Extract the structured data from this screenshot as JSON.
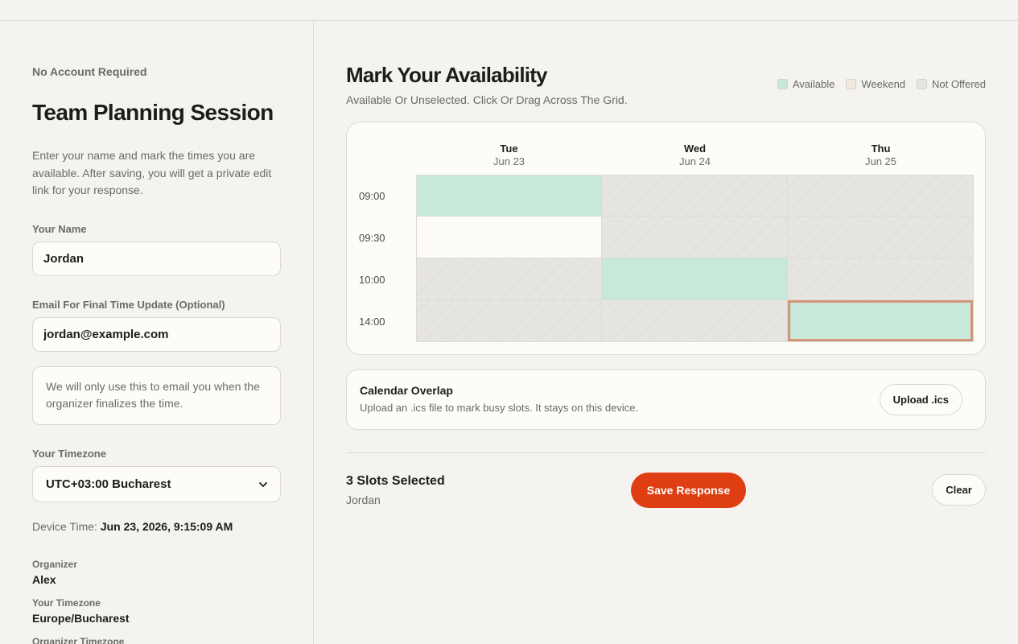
{
  "sidebar": {
    "eyebrow": "No Account Required",
    "title": "Team Planning Session",
    "intro": "Enter your name and mark the times you are available. After saving, you will get a private edit link for your response.",
    "name_label": "Your Name",
    "name_value": "Jordan",
    "email_label": "Email For Final Time Update (Optional)",
    "email_value": "jordan@example.com",
    "email_note": "We will only use this to email you when the organizer finalizes the time.",
    "timezone_label": "Your Timezone",
    "timezone_value": "UTC+03:00 Bucharest",
    "device_time_label": "Device Time:",
    "device_time_value": "Jun 23, 2026, 9:15:09 AM",
    "meta": [
      {
        "label": "Organizer",
        "value": "Alex"
      },
      {
        "label": "Your Timezone",
        "value": "Europe/Bucharest"
      },
      {
        "label": "Organizer Timezone",
        "value": ""
      }
    ]
  },
  "main": {
    "title": "Mark Your Availability",
    "subtitle": "Available Or Unselected. Click Or Drag Across The Grid.",
    "legend": [
      {
        "label": "Available",
        "color": "#c8e8da"
      },
      {
        "label": "Weekend",
        "color": "#efe9dc"
      },
      {
        "label": "Not Offered",
        "color": "#e6e5e1"
      }
    ],
    "days": [
      {
        "name": "Tue",
        "date": "Jun 23"
      },
      {
        "name": "Wed",
        "date": "Jun 24"
      },
      {
        "name": "Thu",
        "date": "Jun 25"
      }
    ],
    "times": [
      "09:00",
      "09:30",
      "10:00",
      "14:00"
    ],
    "slots": [
      [
        "available",
        "not-offered",
        "not-offered"
      ],
      [
        "open",
        "not-offered",
        "not-offered"
      ],
      [
        "not-offered",
        "available",
        "not-offered"
      ],
      [
        "not-offered",
        "not-offered",
        "available-focused"
      ]
    ],
    "overlay": {
      "title": "Calendar Overlap",
      "description": "Upload an .ics file to mark busy slots. It stays on this device.",
      "button_label": "Upload .ics"
    },
    "summary": {
      "count": "3 Slots Selected",
      "name": "Jordan",
      "save_label": "Save Response",
      "clear_label": "Clear"
    }
  },
  "colors": {
    "accent": "#de3e12",
    "available": "#c8e8da",
    "focus_outline": "#d19579"
  }
}
